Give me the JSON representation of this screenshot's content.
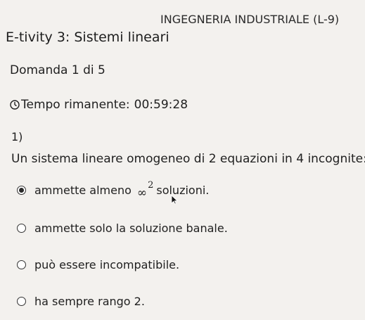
{
  "header": {
    "course": "INGEGNERIA INDUSTRIALE (L-9)",
    "title": "E-tivity 3: Sistemi lineari"
  },
  "quiz": {
    "question_counter": "Domanda 1 di 5",
    "timer_label": "Tempo rimanente:",
    "timer_value": "00:59:28",
    "question_index": "1)",
    "question_text": "Un sistema lineare omogeneo di 2 equazioni in 4 incognite:",
    "options": [
      {
        "text_before": "ammette almeno",
        "math_base": "∞",
        "math_exp": "2",
        "text_after": "soluzioni.",
        "selected": true
      },
      {
        "text": "ammette solo la soluzione banale.",
        "selected": false
      },
      {
        "text": "può essere incompatibile.",
        "selected": false
      },
      {
        "text": "ha sempre rango 2.",
        "selected": false
      }
    ]
  },
  "icons": {
    "timer": "clock-icon",
    "pointer": "mouse-cursor-icon"
  },
  "colors": {
    "background": "#f3f1ee",
    "text": "#1f1f1f"
  }
}
